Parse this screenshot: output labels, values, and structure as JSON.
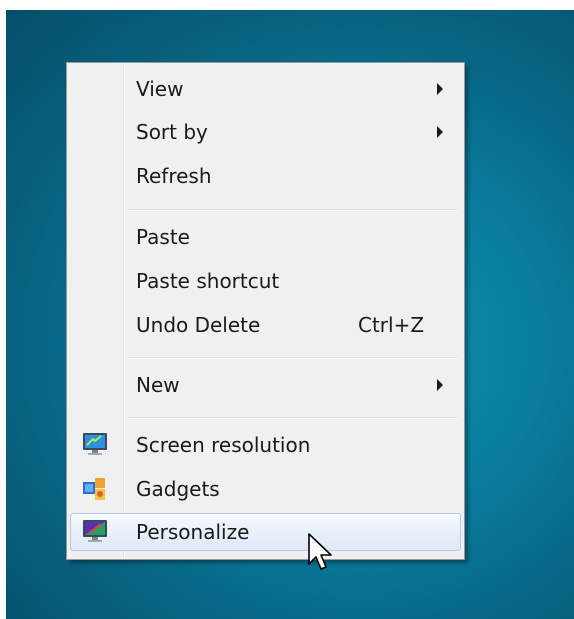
{
  "menu": {
    "items": [
      {
        "label": "View",
        "has_submenu": true
      },
      {
        "label": "Sort by",
        "has_submenu": true
      },
      {
        "label": "Refresh"
      },
      {
        "label": "Paste"
      },
      {
        "label": "Paste shortcut"
      },
      {
        "label": "Undo Delete",
        "shortcut": "Ctrl+Z"
      },
      {
        "label": "New",
        "has_submenu": true
      },
      {
        "label": "Screen resolution",
        "icon": "monitor-icon"
      },
      {
        "label": "Gadgets",
        "icon": "gadgets-icon"
      },
      {
        "label": "Personalize",
        "icon": "personalize-monitor-icon",
        "highlighted": true
      }
    ]
  },
  "colors": {
    "desktop": "#0a7e9f",
    "menu_background": "#f0f0f0",
    "highlight_border": "#aeccf1"
  }
}
